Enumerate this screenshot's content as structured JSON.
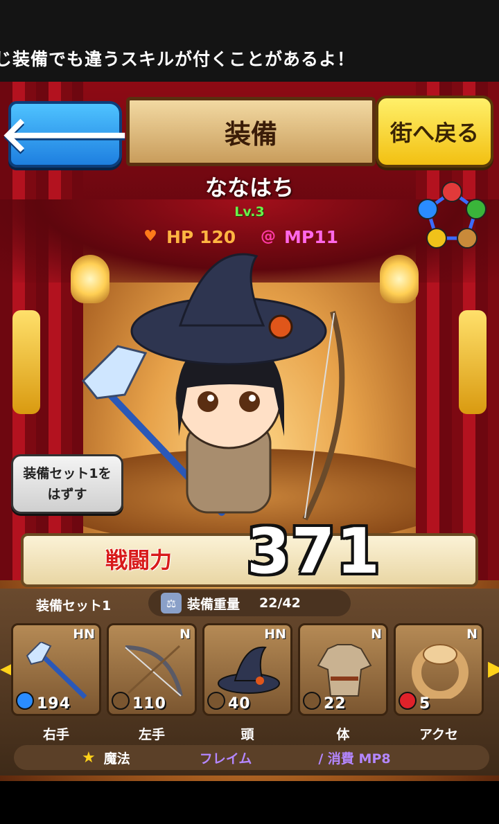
{
  "ticker": {
    "text": "じ装備でも違うスキルが付くことがあるよ！"
  },
  "header": {
    "back_label": "🡐",
    "title": "装備",
    "town_button": "街へ戻る"
  },
  "character": {
    "name": "ななはち",
    "level": "Lv.3",
    "hp_label": "HP 120",
    "mp_label": "MP11",
    "hp_icon": "heart-icon",
    "mp_icon": "swirl-icon"
  },
  "unequip_button": "装備セット1を\nはずす",
  "power": {
    "label": "戦闘力",
    "value": "371"
  },
  "equip_set": {
    "set_name": "装備セット1",
    "weight_label": "装備重量",
    "weight_value": "22/42"
  },
  "slots": [
    {
      "name": "右手",
      "grade": "HN",
      "value": "194",
      "element_color": "#2a8cff",
      "icon": "crystal-staff-icon"
    },
    {
      "name": "左手",
      "grade": "N",
      "value": "110",
      "element_color": "#7a5630",
      "icon": "bow-icon"
    },
    {
      "name": "頭",
      "grade": "HN",
      "value": "40",
      "element_color": "#7a5630",
      "icon": "witch-hat-icon"
    },
    {
      "name": "体",
      "grade": "N",
      "value": "22",
      "element_color": "#7a5630",
      "icon": "armor-icon"
    },
    {
      "name": "アクセ",
      "grade": "N",
      "value": "5",
      "element_color": "#e0222a",
      "icon": "ring-icon"
    }
  ],
  "magic": {
    "label": "魔法",
    "name": "フレイム",
    "cost": "/ 消費 MP8"
  },
  "colors": {
    "back_button": "#1e7fe0",
    "town_button": "#f2c012",
    "power_label": "#d81a1a",
    "level": "#6bf04a",
    "hp": "#ffb542",
    "mp": "#ff68e9",
    "magic_text": "#b487ff"
  }
}
